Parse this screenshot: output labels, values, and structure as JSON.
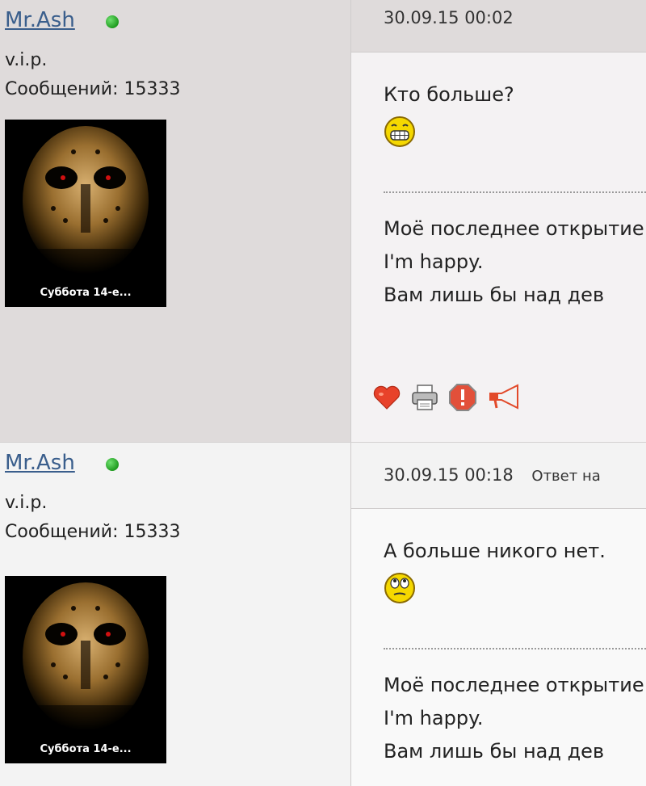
{
  "posts": [
    {
      "author": "Mr.Ash",
      "rank": "v.i.p.",
      "messages_label": "Сообщений: 15333",
      "avatar_caption": "Суббота 14-е...",
      "date": "30.09.15 00:02",
      "reply_to": "",
      "text": "Кто больше?",
      "smiley": "grin-smiley-icon",
      "signature": [
        "Моё последнее открытие",
        "I'm happy.",
        "Вам лишь бы над дев"
      ]
    },
    {
      "author": "Mr.Ash",
      "rank": "v.i.p.",
      "messages_label": "Сообщений: 15333",
      "avatar_caption": "Суббота 14-е...",
      "date": "30.09.15 00:18",
      "reply_to": "Ответ на",
      "text": "А больше никого нет.",
      "smiley": "rolling-eyes-smiley-icon",
      "signature": [
        "Моё последнее открытие",
        "I'm happy.",
        "Вам лишь бы над дев"
      ]
    }
  ],
  "actions": [
    "heart-icon",
    "print-icon",
    "report-icon",
    "megaphone-icon"
  ],
  "colors": {
    "online": "#2ea52e",
    "link": "#3a5e8c"
  }
}
